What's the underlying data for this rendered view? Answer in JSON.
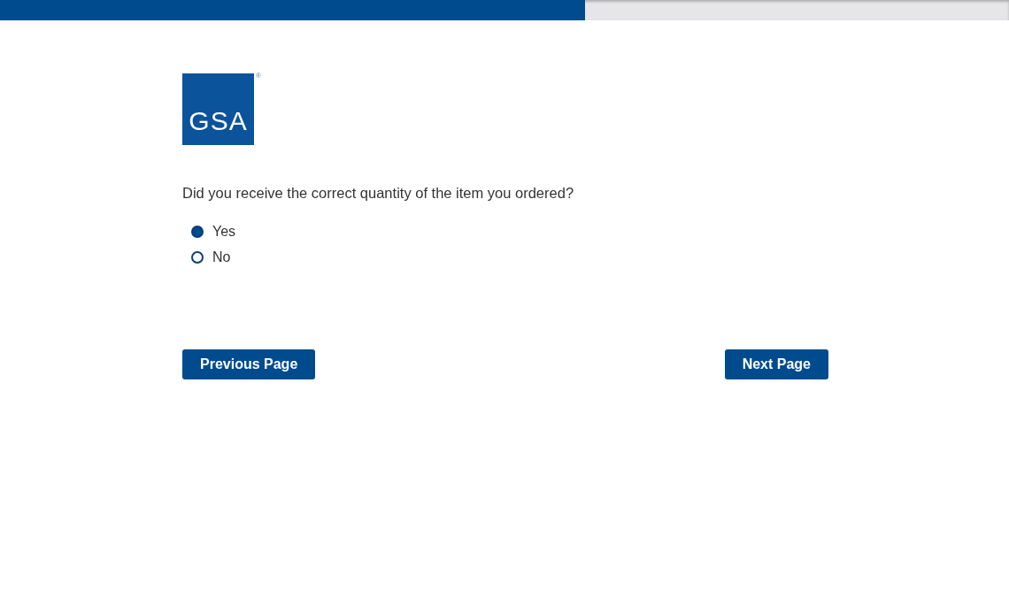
{
  "progress": {
    "level": 0.58
  },
  "logo": {
    "text": "GSA",
    "mark": "®"
  },
  "question": "Did you receive the correct quantity of the item you ordered?",
  "options": [
    {
      "label": "Yes",
      "selected": true
    },
    {
      "label": "No",
      "selected": false
    }
  ],
  "buttons": [
    {
      "label": "Previous Page"
    },
    {
      "label": "Next Page"
    }
  ]
}
